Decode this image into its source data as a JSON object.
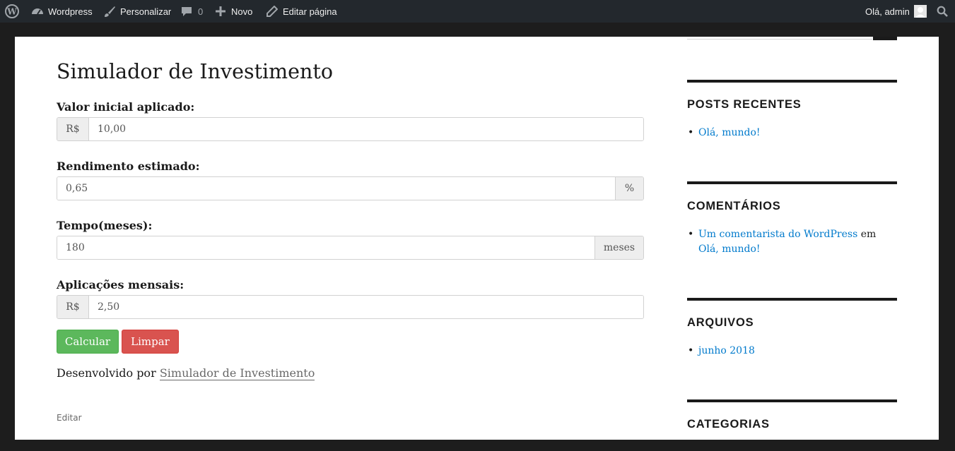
{
  "adminbar": {
    "site_name": "Wordpress",
    "customize": "Personalizar",
    "comments_count": "0",
    "new": "Novo",
    "edit_page": "Editar página",
    "greeting": "Olá, admin",
    "icons": [
      "wordpress-logo-icon",
      "dashboard-icon",
      "brush-icon",
      "comment-icon",
      "plus-icon",
      "pencil-icon",
      "avatar",
      "search-icon"
    ]
  },
  "main": {
    "title": "Simulador de Investimento",
    "fields": {
      "initial": {
        "label": "Valor inicial aplicado:",
        "prefix": "R$",
        "value": "10,00"
      },
      "rate": {
        "label": "Rendimento estimado:",
        "value": "0,65",
        "suffix": "%"
      },
      "time": {
        "label": "Tempo(meses):",
        "value": "180",
        "suffix": "meses"
      },
      "monthly": {
        "label": "Aplicações mensais:",
        "prefix": "R$",
        "value": "2,50"
      }
    },
    "buttons": {
      "calculate": "Calcular",
      "clear": "Limpar"
    },
    "credit": {
      "text": "Desenvolvido por",
      "link": "Simulador de Investimento"
    },
    "edit": "Editar"
  },
  "sidebar": {
    "recent_posts": {
      "title": "POSTS RECENTES",
      "items": [
        "Olá, mundo!"
      ]
    },
    "comments": {
      "title": "COMENTÁRIOS",
      "author": "Um comentarista do WordPress",
      "connector": "em",
      "post": "Olá, mundo!"
    },
    "archives": {
      "title": "ARQUIVOS",
      "items": [
        "junho 2018"
      ]
    },
    "categories": {
      "title": "CATEGORIAS"
    }
  },
  "colors": {
    "adminbar_bg": "#23282d",
    "calculate_btn": "#5cb85c",
    "clear_btn": "#d9534f",
    "link": "#007acc"
  }
}
